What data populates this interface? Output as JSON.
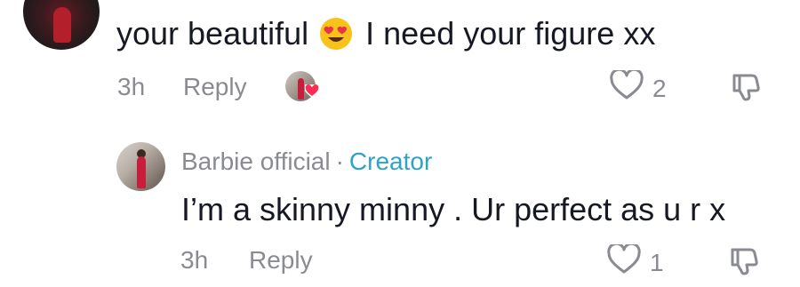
{
  "comment": {
    "text_before_emoji": "your beautiful",
    "emoji": "heart-eyes-emoji",
    "text_after_emoji": "I need your figure xx",
    "time": "3h",
    "reply_label": "Reply",
    "like_count": "2",
    "creator_liked": true
  },
  "reply": {
    "author": "Barbie official",
    "separator": "·",
    "author_badge": "Creator",
    "text": "I’m a skinny minny . Ur perfect as u r x",
    "time": "3h",
    "reply_label": "Reply",
    "like_count": "1"
  },
  "colors": {
    "text_primary": "#161823",
    "text_secondary": "#8a8b91",
    "creator_accent": "#2fa3c7",
    "heart_badge": "#fe2c55"
  },
  "icons": {
    "like": "heart-outline-icon",
    "dislike": "thumbs-down-outline-icon",
    "liked_by_creator": "heart-badge-icon"
  }
}
